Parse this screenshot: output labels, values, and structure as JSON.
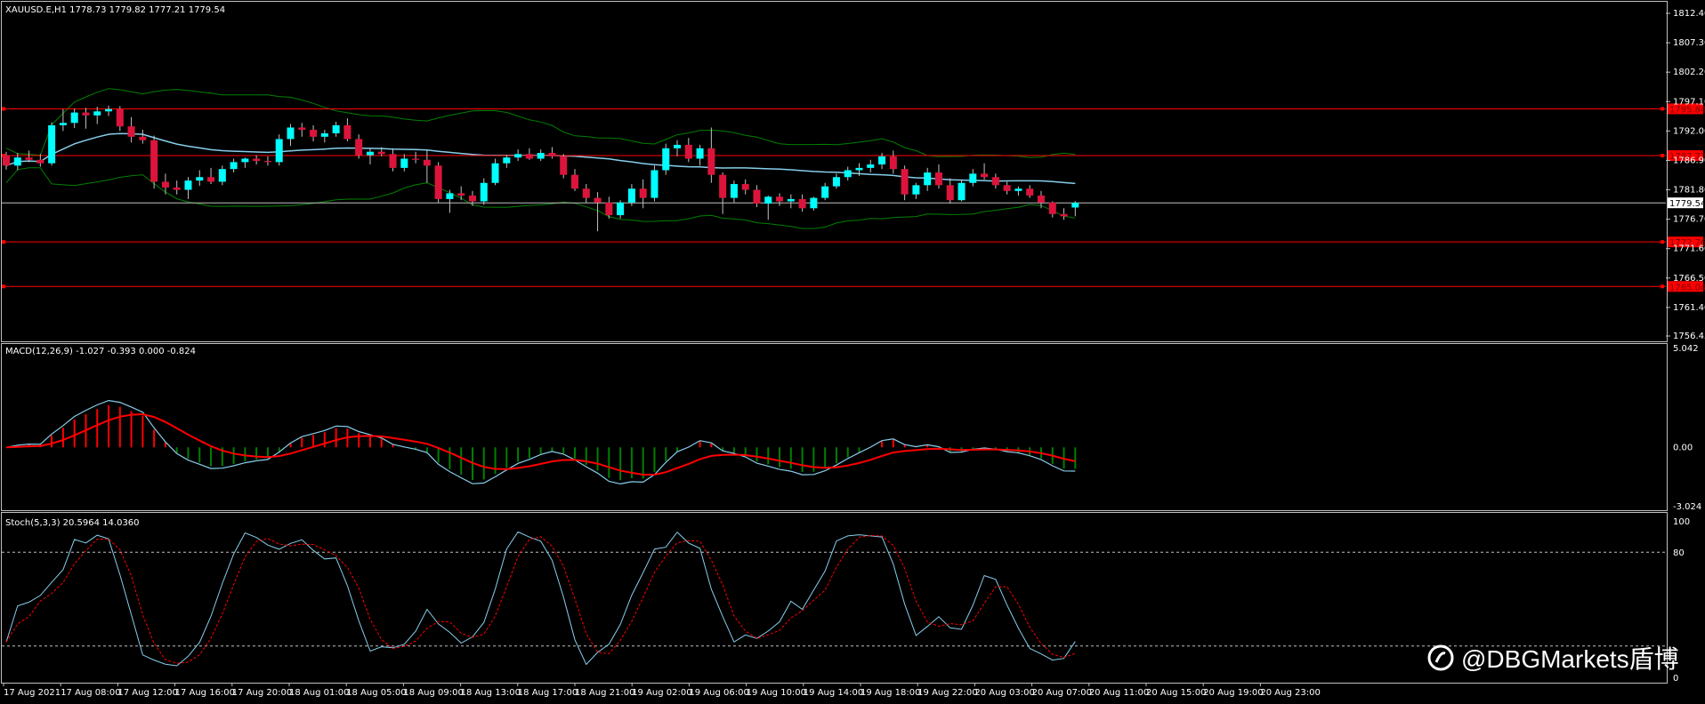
{
  "header": {
    "main": "XAUUSD.E,H1  1778.73 1779.82 1777.21 1779.54",
    "macd": "MACD(12,26,9) -1.027 -0.393 0.000 -0.824",
    "stoch": "Stoch(5,3,3) 20.5964 14.0360"
  },
  "price_axis": [
    "1812.40",
    "1807.30",
    "1802.20",
    "1797.10",
    "1792.00",
    "1786.90",
    "1781.80",
    "1776.70",
    "1771.60",
    "1766.50",
    "1761.40",
    "1756.45"
  ],
  "levels": [
    {
      "price": "1795.84",
      "color": "#ff0000"
    },
    {
      "price": "1787.73",
      "color": "#ff0000"
    },
    {
      "price": "1772.76",
      "color": "#ff0000"
    },
    {
      "price": "1765.04",
      "color": "#ff0000"
    }
  ],
  "current_price": "1779.54",
  "macd_axis": {
    "top": "5.042",
    "mid": "0.00",
    "bottom": "-3.024"
  },
  "stoch_axis": {
    "top": "100",
    "upper": "80",
    "lower": "20",
    "bottom": "0"
  },
  "time_axis": [
    "17 Aug 2021",
    "17 Aug 08:00",
    "17 Aug 12:00",
    "17 Aug 16:00",
    "17 Aug 20:00",
    "18 Aug 01:00",
    "18 Aug 05:00",
    "18 Aug 09:00",
    "18 Aug 13:00",
    "18 Aug 17:00",
    "18 Aug 21:00",
    "19 Aug 02:00",
    "19 Aug 06:00",
    "19 Aug 10:00",
    "19 Aug 14:00",
    "19 Aug 18:00",
    "19 Aug 22:00",
    "20 Aug 03:00",
    "20 Aug 07:00",
    "20 Aug 11:00",
    "20 Aug 15:00",
    "20 Aug 19:00",
    "20 Aug 23:00"
  ],
  "watermark": "@DBGMarkets盾博",
  "colors": {
    "bull": "#00ffff",
    "bear": "#dc143c",
    "signal": "#ff0000",
    "band": "#008000",
    "ma": "#87ceeb",
    "hist_pos": "#ff0000",
    "hist_neg": "#008000"
  },
  "chart_data": {
    "type": "candlestick",
    "symbol": "XAUUSD.E",
    "timeframe": "H1",
    "candles": [
      [
        1787.8,
        1788.4,
        1785.3,
        1786.0
      ],
      [
        1786.0,
        1788.2,
        1785.2,
        1787.4
      ],
      [
        1787.4,
        1788.6,
        1786.6,
        1787.0
      ],
      [
        1787.0,
        1788.0,
        1785.8,
        1786.4
      ],
      [
        1786.4,
        1793.5,
        1786.0,
        1793.0
      ],
      [
        1793.0,
        1795.8,
        1792.0,
        1793.4
      ],
      [
        1793.4,
        1795.9,
        1792.5,
        1795.2
      ],
      [
        1795.2,
        1796.0,
        1792.4,
        1794.7
      ],
      [
        1794.7,
        1796.2,
        1793.2,
        1795.4
      ],
      [
        1795.4,
        1796.4,
        1794.6,
        1795.8
      ],
      [
        1795.8,
        1796.3,
        1792.0,
        1792.8
      ],
      [
        1792.8,
        1794.4,
        1790.0,
        1791.0
      ],
      [
        1791.0,
        1792.2,
        1789.8,
        1790.4
      ],
      [
        1790.4,
        1791.2,
        1782.0,
        1783.2
      ],
      [
        1783.2,
        1784.6,
        1781.0,
        1782.2
      ],
      [
        1782.2,
        1783.4,
        1781.0,
        1781.8
      ],
      [
        1781.8,
        1784.0,
        1780.2,
        1783.4
      ],
      [
        1783.4,
        1785.2,
        1782.5,
        1784.0
      ],
      [
        1784.0,
        1785.6,
        1782.8,
        1783.2
      ],
      [
        1783.2,
        1786.0,
        1782.6,
        1785.4
      ],
      [
        1785.4,
        1787.2,
        1784.8,
        1786.6
      ],
      [
        1786.6,
        1787.4,
        1785.6,
        1787.2
      ],
      [
        1787.2,
        1787.8,
        1786.2,
        1786.8
      ],
      [
        1786.8,
        1787.6,
        1786.0,
        1786.6
      ],
      [
        1786.6,
        1791.4,
        1786.0,
        1790.6
      ],
      [
        1790.6,
        1793.2,
        1789.4,
        1792.6
      ],
      [
        1792.6,
        1793.4,
        1791.0,
        1792.2
      ],
      [
        1792.2,
        1793.0,
        1790.2,
        1791.0
      ],
      [
        1791.0,
        1792.2,
        1790.0,
        1791.6
      ],
      [
        1791.6,
        1793.6,
        1791.0,
        1793.0
      ],
      [
        1793.0,
        1794.2,
        1790.2,
        1790.6
      ],
      [
        1790.6,
        1791.4,
        1787.2,
        1787.8
      ],
      [
        1787.8,
        1789.0,
        1786.2,
        1788.4
      ],
      [
        1788.4,
        1789.2,
        1787.6,
        1788.0
      ],
      [
        1788.0,
        1789.0,
        1785.0,
        1785.6
      ],
      [
        1785.6,
        1788.0,
        1785.0,
        1787.2
      ],
      [
        1787.2,
        1788.4,
        1786.4,
        1787.0
      ],
      [
        1787.0,
        1788.6,
        1783.0,
        1786.0
      ],
      [
        1786.0,
        1786.6,
        1779.6,
        1780.2
      ],
      [
        1780.2,
        1781.8,
        1777.8,
        1781.2
      ],
      [
        1781.2,
        1782.4,
        1780.0,
        1780.8
      ],
      [
        1780.8,
        1781.6,
        1779.0,
        1779.8
      ],
      [
        1779.8,
        1783.8,
        1779.2,
        1783.0
      ],
      [
        1783.0,
        1787.2,
        1782.6,
        1786.4
      ],
      [
        1786.4,
        1787.8,
        1785.6,
        1787.4
      ],
      [
        1787.4,
        1788.8,
        1786.8,
        1788.0
      ],
      [
        1788.0,
        1789.0,
        1787.0,
        1787.2
      ],
      [
        1787.2,
        1788.8,
        1786.8,
        1788.2
      ],
      [
        1788.2,
        1789.2,
        1787.2,
        1787.6
      ],
      [
        1787.6,
        1788.0,
        1783.8,
        1784.4
      ],
      [
        1784.4,
        1785.4,
        1781.6,
        1782.0
      ],
      [
        1782.0,
        1782.8,
        1779.6,
        1780.4
      ],
      [
        1780.4,
        1781.4,
        1774.6,
        1779.6
      ],
      [
        1779.6,
        1780.6,
        1776.8,
        1777.4
      ],
      [
        1777.4,
        1780.0,
        1776.8,
        1779.6
      ],
      [
        1779.6,
        1782.8,
        1779.0,
        1782.0
      ],
      [
        1782.0,
        1783.6,
        1778.6,
        1780.4
      ],
      [
        1780.4,
        1786.0,
        1779.8,
        1785.2
      ],
      [
        1785.2,
        1789.8,
        1784.4,
        1789.0
      ],
      [
        1789.0,
        1790.4,
        1787.6,
        1789.6
      ],
      [
        1789.6,
        1790.8,
        1786.6,
        1787.2
      ],
      [
        1787.2,
        1789.6,
        1786.0,
        1789.0
      ],
      [
        1789.0,
        1792.6,
        1783.0,
        1784.4
      ],
      [
        1784.4,
        1784.8,
        1777.6,
        1780.4
      ],
      [
        1780.4,
        1783.4,
        1779.6,
        1782.8
      ],
      [
        1782.8,
        1783.6,
        1781.0,
        1781.8
      ],
      [
        1781.8,
        1782.6,
        1778.8,
        1779.4
      ],
      [
        1779.4,
        1780.8,
        1776.6,
        1780.6
      ],
      [
        1780.6,
        1781.2,
        1779.0,
        1779.8
      ],
      [
        1779.8,
        1781.0,
        1778.6,
        1780.2
      ],
      [
        1780.2,
        1781.0,
        1778.0,
        1778.6
      ],
      [
        1778.6,
        1780.6,
        1778.2,
        1780.4
      ],
      [
        1780.4,
        1783.0,
        1780.0,
        1782.4
      ],
      [
        1782.4,
        1784.6,
        1782.0,
        1784.0
      ],
      [
        1784.0,
        1785.8,
        1783.4,
        1785.2
      ],
      [
        1785.2,
        1786.4,
        1784.2,
        1785.6
      ],
      [
        1785.6,
        1787.0,
        1784.8,
        1786.2
      ],
      [
        1786.2,
        1788.2,
        1785.4,
        1787.6
      ],
      [
        1787.6,
        1788.6,
        1784.6,
        1785.4
      ],
      [
        1785.4,
        1786.0,
        1780.0,
        1781.0
      ],
      [
        1781.0,
        1783.0,
        1780.2,
        1782.6
      ],
      [
        1782.6,
        1785.6,
        1781.6,
        1784.8
      ],
      [
        1784.8,
        1786.2,
        1782.0,
        1782.6
      ],
      [
        1782.6,
        1783.8,
        1779.4,
        1780.0
      ],
      [
        1780.0,
        1783.6,
        1779.8,
        1783.0
      ],
      [
        1783.0,
        1785.4,
        1782.4,
        1784.6
      ],
      [
        1784.6,
        1786.4,
        1783.6,
        1784.0
      ],
      [
        1784.0,
        1784.6,
        1782.0,
        1782.6
      ],
      [
        1782.6,
        1783.2,
        1781.0,
        1781.6
      ],
      [
        1781.6,
        1782.4,
        1780.8,
        1782.0
      ],
      [
        1782.0,
        1782.6,
        1780.4,
        1780.8
      ],
      [
        1780.8,
        1781.6,
        1778.6,
        1779.6
      ],
      [
        1779.6,
        1779.8,
        1777.0,
        1777.6
      ],
      [
        1777.6,
        1778.6,
        1776.6,
        1777.2
      ],
      [
        1778.73,
        1779.82,
        1777.21,
        1779.54
      ]
    ],
    "price_range": [
      1756.45,
      1814.0
    ]
  }
}
